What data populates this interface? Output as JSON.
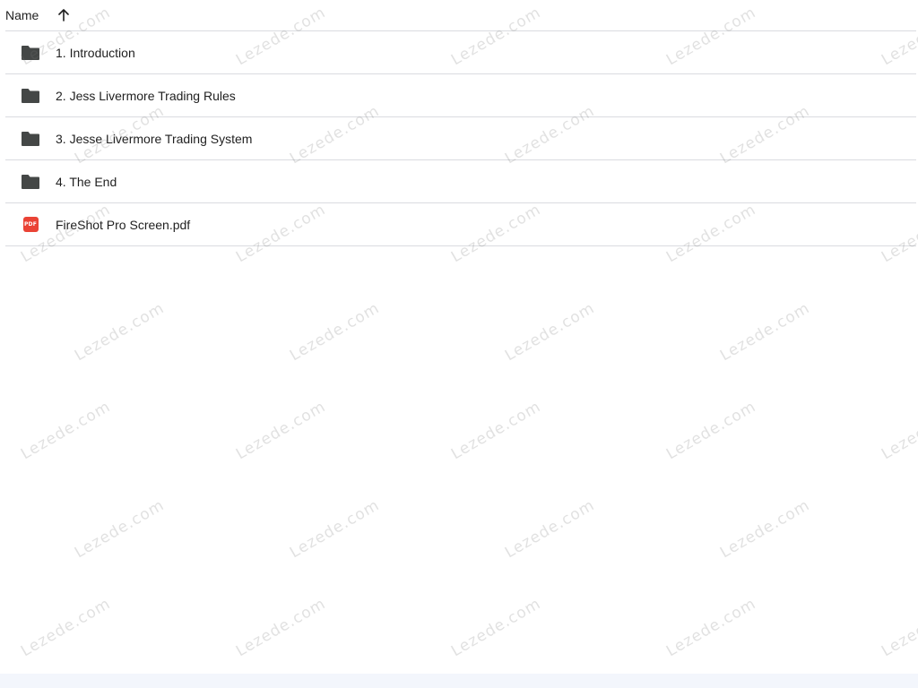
{
  "header": {
    "name_label": "Name",
    "sort_icon": "arrow-up-icon"
  },
  "files": [
    {
      "label": "1. Introduction",
      "type": "folder",
      "icon": "folder-icon"
    },
    {
      "label": "2. Jess Livermore Trading Rules",
      "type": "folder",
      "icon": "folder-icon"
    },
    {
      "label": "3. Jesse Livermore Trading System",
      "type": "folder",
      "icon": "folder-icon"
    },
    {
      "label": "4. The End",
      "type": "folder",
      "icon": "folder-icon"
    },
    {
      "label": "FireShot Pro Screen.pdf",
      "type": "pdf",
      "icon": "pdf-icon",
      "badge": "PDF"
    }
  ],
  "watermark": {
    "text": "Lezede.com",
    "color": "#787878"
  },
  "colors": {
    "folder": "#444746",
    "pdf": "#ea4335",
    "divider": "#dadce0"
  }
}
